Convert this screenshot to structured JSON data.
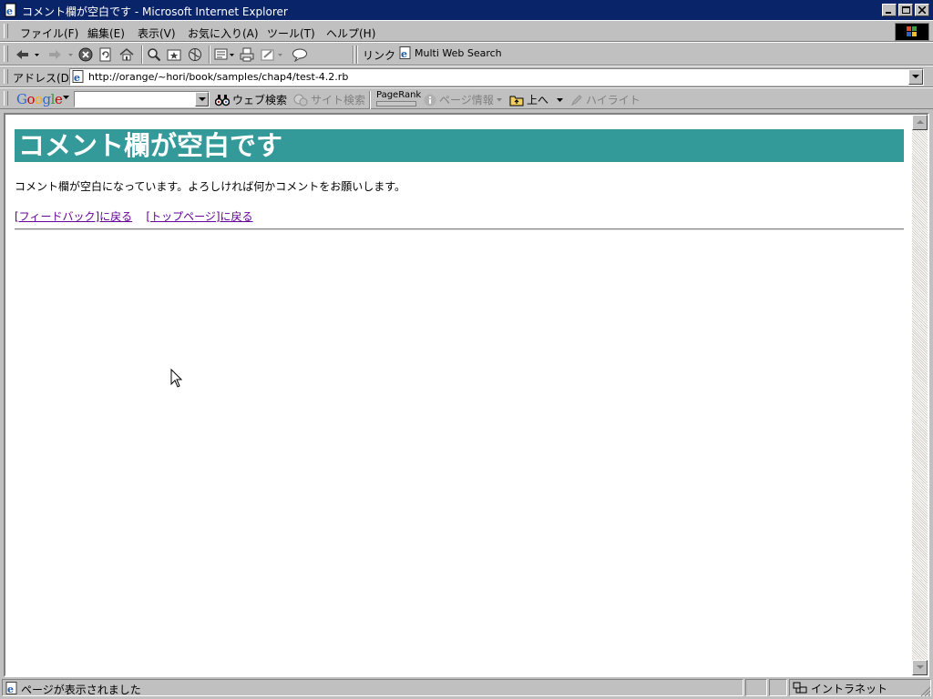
{
  "window": {
    "title": "コメント欄が空白です - Microsoft Internet Explorer"
  },
  "menu": {
    "items": [
      "ファイル(F)",
      "編集(E)",
      "表示(V)",
      "お気に入り(A)",
      "ツール(T)",
      "ヘルプ(H)"
    ]
  },
  "toolbar": {
    "links_label": "リンク",
    "links_item": "Multi Web Search"
  },
  "address": {
    "label": "アドレス(D)",
    "url": "http://orange/~hori/book/samples/chap4/test-4.2.rb"
  },
  "google": {
    "logo": "Google",
    "search_value": "",
    "web_search": "ウェブ検索",
    "site_search": "サイト検索",
    "pagerank": "PageRank",
    "page_info": "ページ情報",
    "up": "上へ",
    "highlight": "ハイライト"
  },
  "page": {
    "heading": "コメント欄が空白です",
    "message": "コメント欄が空白になっています。よろしければ何かコメントをお願いします。",
    "link_feedback": "[フィードバック]に戻る",
    "link_top": "[トップページ]に戻る"
  },
  "status": {
    "text": "ページが表示されました",
    "zone": "イントラネット"
  },
  "colors": {
    "titlebar": "#0a246a",
    "heading_bg": "#339999",
    "visited_link": "#660099"
  }
}
